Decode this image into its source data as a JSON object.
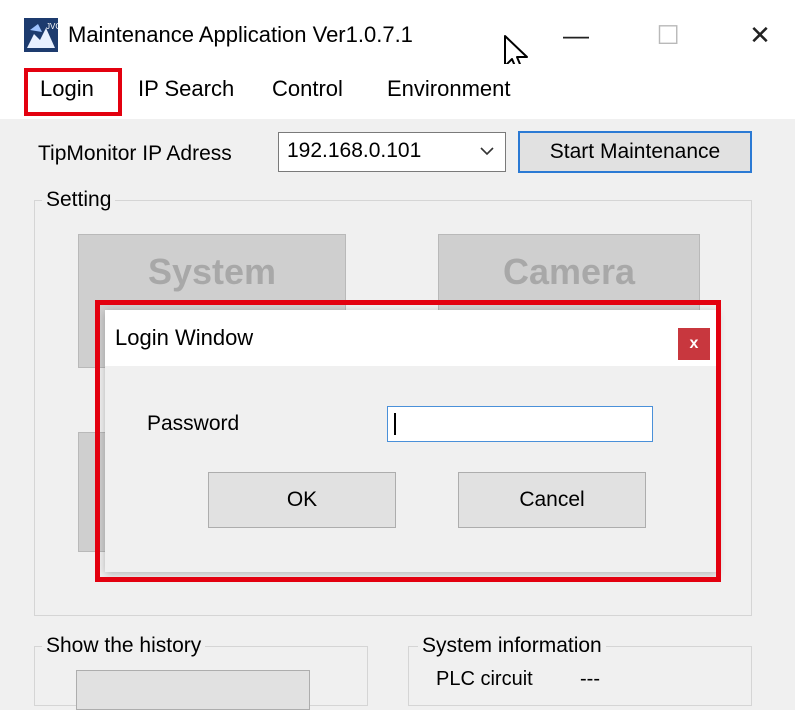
{
  "window": {
    "title": "Maintenance Application Ver1.0.7.1",
    "icon": "jvc-app-icon",
    "controls": {
      "minimize": "—",
      "maximize": "☐",
      "close": "✕"
    }
  },
  "menu": {
    "items": [
      {
        "label": "Login",
        "highlighted": true
      },
      {
        "label": "IP Search"
      },
      {
        "label": "Control"
      },
      {
        "label": "Environment"
      }
    ]
  },
  "connection": {
    "ip_label": "TipMonitor IP Adress",
    "ip_value": "192.168.0.101",
    "start_button": "Start Maintenance"
  },
  "setting": {
    "group_label": "Setting",
    "buttons": [
      {
        "label": "System"
      },
      {
        "label": "Camera"
      }
    ]
  },
  "history": {
    "group_label": "Show the history"
  },
  "system_info": {
    "group_label": "System information",
    "rows": [
      {
        "label": "PLC circuit",
        "value": "---"
      }
    ]
  },
  "login_dialog": {
    "title": "Login Window",
    "close_label": "x",
    "password_label": "Password",
    "password_value": "",
    "ok_label": "OK",
    "cancel_label": "Cancel"
  },
  "colors": {
    "highlight": "#e3000f",
    "focus_border": "#2b7ad4",
    "dialog_close": "#c8373e"
  }
}
